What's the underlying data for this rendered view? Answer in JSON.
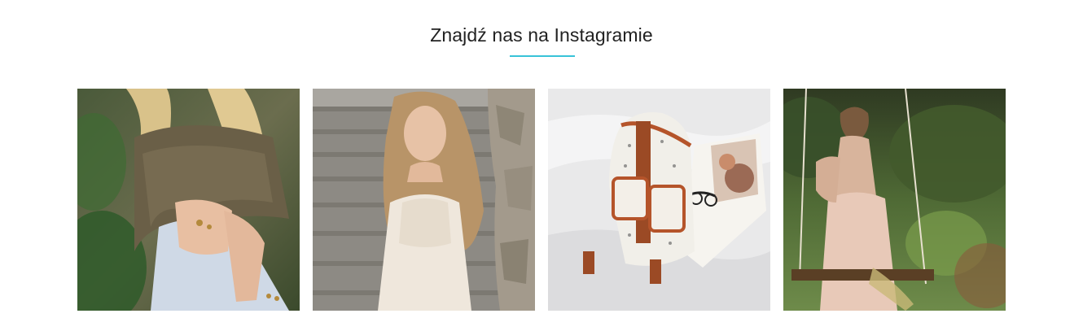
{
  "section": {
    "title": "Znajdź nas na Instagramie",
    "accent_color": "#38c3d8"
  },
  "gallery": {
    "items": [
      {
        "name": "instagram-photo-1",
        "subject": "woman in knit cardigan with rings, sitting on grass"
      },
      {
        "name": "instagram-photo-2",
        "subject": "blonde woman in white dress sitting on stone steps"
      },
      {
        "name": "instagram-photo-3",
        "subject": "printed canvas backpack with brown straps, glasses and magazine on white bedding"
      },
      {
        "name": "instagram-photo-4",
        "subject": "woman in pink strapless dress sitting on a rope swing in a garden"
      }
    ]
  }
}
